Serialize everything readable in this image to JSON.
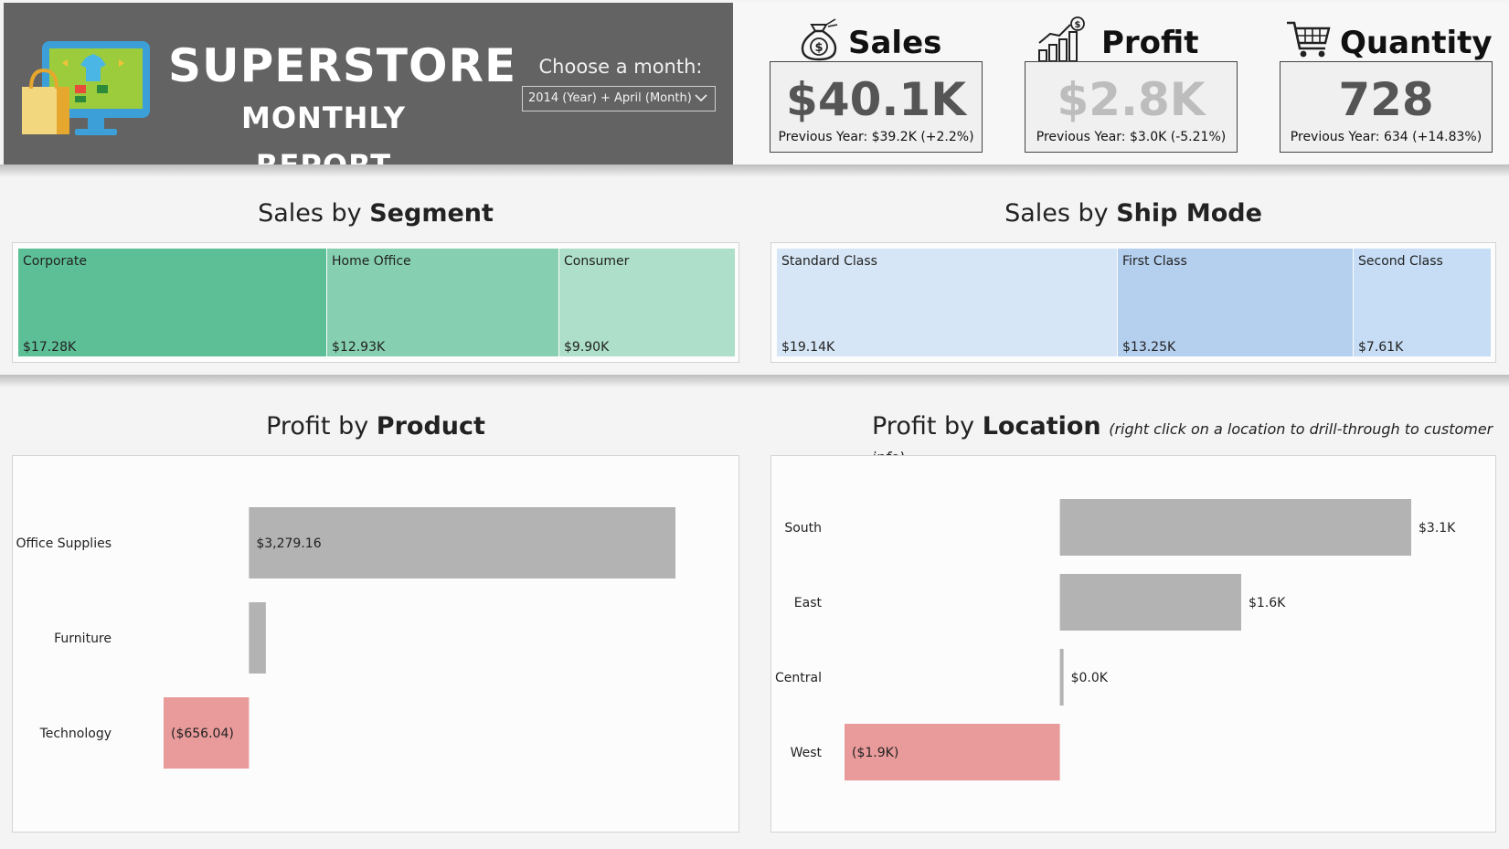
{
  "header": {
    "title": "SUPERSTORE",
    "subtitle": "MONTHLY REPORT",
    "month_label": "Choose a month:",
    "month_value": "2014 (Year) + April (Month)"
  },
  "kpis": [
    {
      "label": "Sales",
      "value": "$40.1K",
      "previous": "Previous Year: $39.2K (+2.2%)",
      "icon": "money-bag-icon"
    },
    {
      "label": "Profit",
      "value": "$2.8K",
      "previous": "Previous Year: $3.0K (-5.21%)",
      "icon": "growth-coins-icon"
    },
    {
      "label": "Quantity",
      "value": "728",
      "previous": "Previous Year: 634 (+14.83%)",
      "icon": "shopping-cart-icon"
    }
  ],
  "segment": {
    "title_prefix": "Sales by ",
    "title_bold": "Segment",
    "tiles": [
      {
        "label": "Corporate",
        "value": "$17.28K",
        "color": "#5dbf96"
      },
      {
        "label": "Home Office",
        "value": "$12.93K",
        "color": "#86d0b1"
      },
      {
        "label": "Consumer",
        "value": "$9.90K",
        "color": "#addfca"
      }
    ]
  },
  "shipmode": {
    "title_prefix": "Sales by ",
    "title_bold": "Ship Mode",
    "tiles": [
      {
        "label": "Standard Class",
        "value": "$19.14K",
        "color": "#d6e6f6"
      },
      {
        "label": "First Class",
        "value": "$13.25K",
        "color": "#b5d0ef"
      },
      {
        "label": "Second Class",
        "value": "$7.61K",
        "color": "#c6ddf5"
      }
    ]
  },
  "product": {
    "title_prefix": "Profit by ",
    "title_bold": "Product"
  },
  "location": {
    "title_prefix": "Profit by ",
    "title_bold": "Location",
    "note": "(right click on a location to drill-through to customer info)"
  },
  "colors": {
    "positive": "#b3b3b3",
    "negative": "#e99a9a"
  },
  "chart_data": [
    {
      "type": "bar",
      "orientation": "horizontal",
      "title": "Profit by Product",
      "categories": [
        "Office Supplies",
        "Furniture",
        "Technology"
      ],
      "values": [
        3279.16,
        130,
        -656.04
      ],
      "data_labels": [
        "$3,279.16",
        "",
        "($656.04)"
      ]
    },
    {
      "type": "bar",
      "orientation": "horizontal",
      "title": "Profit by Location",
      "categories": [
        "South",
        "East",
        "Central",
        "West"
      ],
      "values": [
        3100,
        1600,
        20,
        -1900
      ],
      "data_labels": [
        "$3.1K",
        "$1.6K",
        "$0.0K",
        "($1.9K)"
      ]
    }
  ]
}
